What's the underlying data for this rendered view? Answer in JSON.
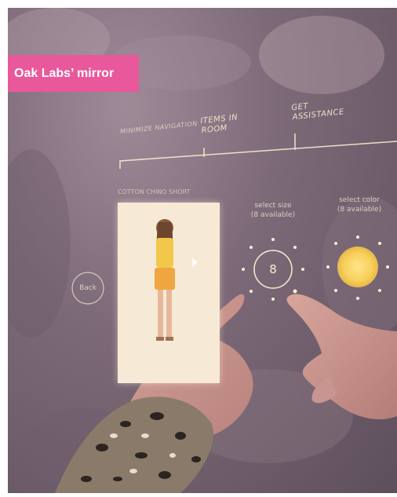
{
  "caption": {
    "label": "Oak Labs’ mirror"
  },
  "mirror_ui": {
    "nav_items": [
      "Minimize Navigation",
      "Items in Room",
      "Get Assistance"
    ],
    "product_name": "COTTON CHINO SHORT",
    "size_selector": {
      "heading": "select size",
      "availability": "(8 available)",
      "value": "8"
    },
    "color_selector": {
      "heading": "select color",
      "availability": "(8 available)"
    },
    "back_button": "Back"
  },
  "colors": {
    "badge": "#e9589b",
    "ui_line": "#f5f0d0",
    "color_swatch": "#f7cf5a"
  }
}
